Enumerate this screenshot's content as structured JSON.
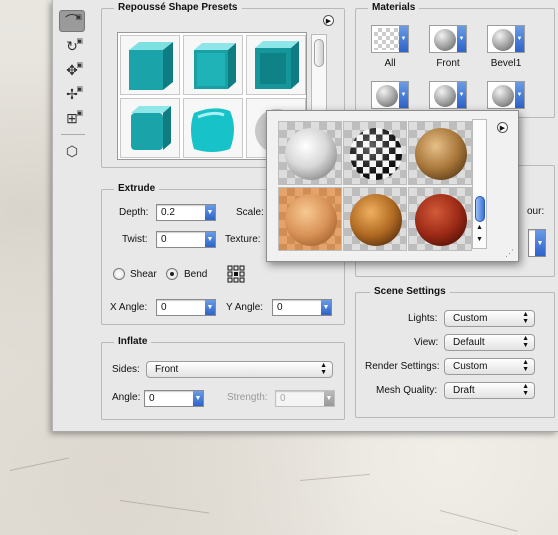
{
  "colors": {
    "accent_blue": "#3a72d8",
    "cube_teal": "#1aa3a8",
    "selected_swatch": "#e4a36b"
  },
  "toolbar": {
    "tools": [
      "shape-tool-icon",
      "rotate-tool-icon",
      "move-tool-icon",
      "scale-tool-icon",
      "mesh-tool-icon",
      "camera-tool-icon"
    ]
  },
  "presets": {
    "title": "Repoussé Shape Presets",
    "items": [
      "cube-preset",
      "bevel-cube-preset",
      "inset-cube-preset",
      "rounded-cube-preset",
      "pillow-preset",
      "sphere-preset"
    ]
  },
  "materials": {
    "title": "Materials",
    "slots_row1": [
      {
        "label": "All"
      },
      {
        "label": "Front"
      },
      {
        "label": "Bevel1"
      }
    ],
    "partial_label": "our:"
  },
  "picker": {
    "swatches": [
      "white-marble",
      "checkerboard",
      "brown-stone",
      "orange-wood",
      "golden-rock",
      "red-glossy"
    ]
  },
  "extrude": {
    "title": "Extrude",
    "depth_label": "Depth:",
    "depth_value": "0.2",
    "scale_label": "Scale:",
    "twist_label": "Twist:",
    "twist_value": "0",
    "texture_label": "Texture:",
    "shear_label": "Shear",
    "bend_label": "Bend",
    "bend_selected": true,
    "xangle_label": "X Angle:",
    "xangle_value": "0",
    "yangle_label": "Y Angle:",
    "yangle_value": "0"
  },
  "inflate": {
    "title": "Inflate",
    "sides_label": "Sides:",
    "sides_value": "Front",
    "angle_label": "Angle:",
    "angle_value": "0",
    "strength_label": "Strength:",
    "strength_value": "0"
  },
  "scene": {
    "title": "Scene Settings",
    "lights_label": "Lights:",
    "lights_value": "Custom",
    "view_label": "View:",
    "view_value": "Default",
    "render_label": "Render Settings:",
    "render_value": "Custom",
    "mesh_label": "Mesh Quality:",
    "mesh_value": "Draft"
  }
}
